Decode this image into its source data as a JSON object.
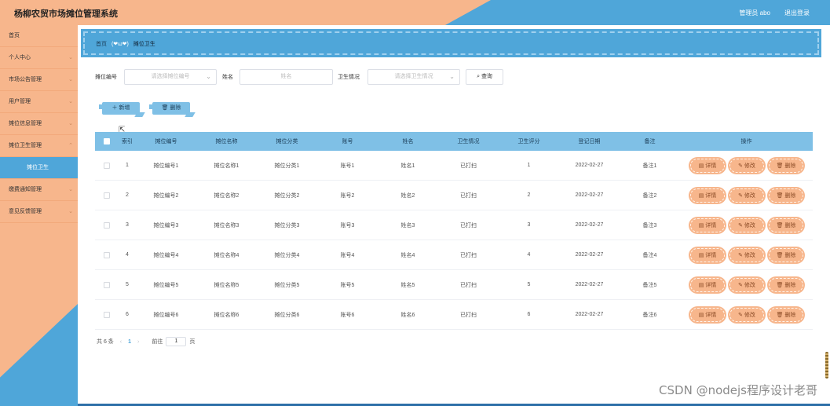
{
  "header": {
    "title": "杨柳农贸市场摊位管理系统",
    "user_text": "管理员 abo",
    "logout_label": "退出登录"
  },
  "sidebar": {
    "items": [
      {
        "label": "首页",
        "chev": ""
      },
      {
        "label": "个人中心",
        "chev": "⌄"
      },
      {
        "label": "市场公告管理",
        "chev": "⌄"
      },
      {
        "label": "用户管理",
        "chev": "⌄"
      },
      {
        "label": "摊位信息管理",
        "chev": "⌄"
      },
      {
        "label": "摊位卫生管理",
        "chev": "⌃"
      },
      {
        "label": "摊位卫生",
        "chev": ""
      },
      {
        "label": "缴费通知管理",
        "chev": "⌄"
      },
      {
        "label": "意见反馈管理",
        "chev": "⌄"
      }
    ]
  },
  "breadcrumb": {
    "home": "首页",
    "emoticon": "(❤ω❤)",
    "current": "摊位卫生"
  },
  "filters": {
    "stall_no_label": "摊位编号",
    "stall_no_placeholder": "请选择摊位编号",
    "name_label": "姓名",
    "name_placeholder": "姓名",
    "hygiene_label": "卫生情况",
    "hygiene_placeholder": "请选择卫生情况",
    "search_label": "查询"
  },
  "actions": {
    "add_label": "新增",
    "delete_label": "删除"
  },
  "table": {
    "columns": [
      "索引",
      "摊位编号",
      "摊位名称",
      "摊位分类",
      "账号",
      "姓名",
      "卫生情况",
      "卫生评分",
      "登记日期",
      "备注",
      "操作"
    ],
    "rows": [
      {
        "idx": "1",
        "stall_no": "摊位编号1",
        "stall_name": "摊位名称1",
        "category": "摊位分类1",
        "account": "账号1",
        "name": "姓名1",
        "hygiene": "已打扫",
        "score": "1",
        "date": "2022-02-27",
        "note": "备注1"
      },
      {
        "idx": "2",
        "stall_no": "摊位编号2",
        "stall_name": "摊位名称2",
        "category": "摊位分类2",
        "account": "账号2",
        "name": "姓名2",
        "hygiene": "已打扫",
        "score": "2",
        "date": "2022-02-27",
        "note": "备注2"
      },
      {
        "idx": "3",
        "stall_no": "摊位编号3",
        "stall_name": "摊位名称3",
        "category": "摊位分类3",
        "account": "账号3",
        "name": "姓名3",
        "hygiene": "已打扫",
        "score": "3",
        "date": "2022-02-27",
        "note": "备注3"
      },
      {
        "idx": "4",
        "stall_no": "摊位编号4",
        "stall_name": "摊位名称4",
        "category": "摊位分类4",
        "account": "账号4",
        "name": "姓名4",
        "hygiene": "已打扫",
        "score": "4",
        "date": "2022-02-27",
        "note": "备注4"
      },
      {
        "idx": "5",
        "stall_no": "摊位编号5",
        "stall_name": "摊位名称5",
        "category": "摊位分类5",
        "account": "账号5",
        "name": "姓名5",
        "hygiene": "已打扫",
        "score": "5",
        "date": "2022-02-27",
        "note": "备注5"
      },
      {
        "idx": "6",
        "stall_no": "摊位编号6",
        "stall_name": "摊位名称6",
        "category": "摊位分类6",
        "account": "账号6",
        "name": "姓名6",
        "hygiene": "已打扫",
        "score": "6",
        "date": "2022-02-27",
        "note": "备注6"
      }
    ],
    "op_labels": {
      "detail": "详情",
      "edit": "修改",
      "delete": "删除"
    }
  },
  "pagination": {
    "total": "共 6 条",
    "current_page": "1",
    "goto_label": "前往",
    "goto_value": "1",
    "page_suffix": "页"
  },
  "watermark": "CSDN @nodejs程序设计老哥",
  "colors": {
    "accent_orange": "#f7b68c",
    "accent_blue": "#4fa6d9",
    "table_header": "#7fc0e6"
  },
  "icons": {
    "search": "search-icon",
    "add": "plus-icon",
    "delete": "trash-icon",
    "detail": "document-icon",
    "edit": "pencil-icon"
  }
}
